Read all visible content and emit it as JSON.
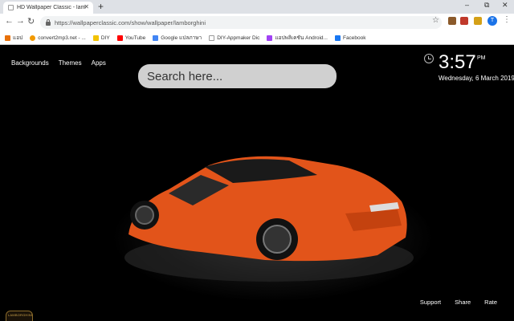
{
  "browser": {
    "tab_title": "HD Wallpaper Classic - lamborghi",
    "tab_close": "✕",
    "new_tab": "+",
    "url": "https://wallpaperclassic.com/show/wallpaper/lamborghini",
    "profile_initial": "T",
    "window_controls": [
      "–",
      "⧉",
      "✕"
    ],
    "icons": [
      "back-icon",
      "forward-icon",
      "reload-icon",
      "lock-icon",
      "star-icon",
      "menu-icon"
    ]
  },
  "bookmarks": [
    {
      "label": "แอป",
      "color": "#e8710a"
    },
    {
      "label": "convert2mp3.net - ...",
      "color": "#f29900"
    },
    {
      "label": "DIY",
      "color": "#f2c200"
    },
    {
      "label": "YouTube",
      "color": "#ff0000"
    },
    {
      "label": "Google แปลภาษา",
      "color": "#4285f4"
    },
    {
      "label": "DIY-Appmaker Dic",
      "color": "#999999"
    },
    {
      "label": "แอปพลิเคชัน Android...",
      "color": "#a142f4"
    },
    {
      "label": "Facebook",
      "color": "#1877f2"
    }
  ],
  "nav": {
    "backgrounds": "Backgrounds",
    "themes": "Themes",
    "apps": "Apps"
  },
  "search": {
    "placeholder": "Search here..."
  },
  "clock": {
    "time": "3:57",
    "ampm": "PM",
    "date": "Wednesday, 6 March 2019"
  },
  "footer": {
    "support": "Support",
    "share": "Share",
    "rate": "Rate"
  },
  "logo": {
    "text": "LAMBORGHINI"
  },
  "colors": {
    "car_body": "#e2541a",
    "background": "#000000"
  }
}
